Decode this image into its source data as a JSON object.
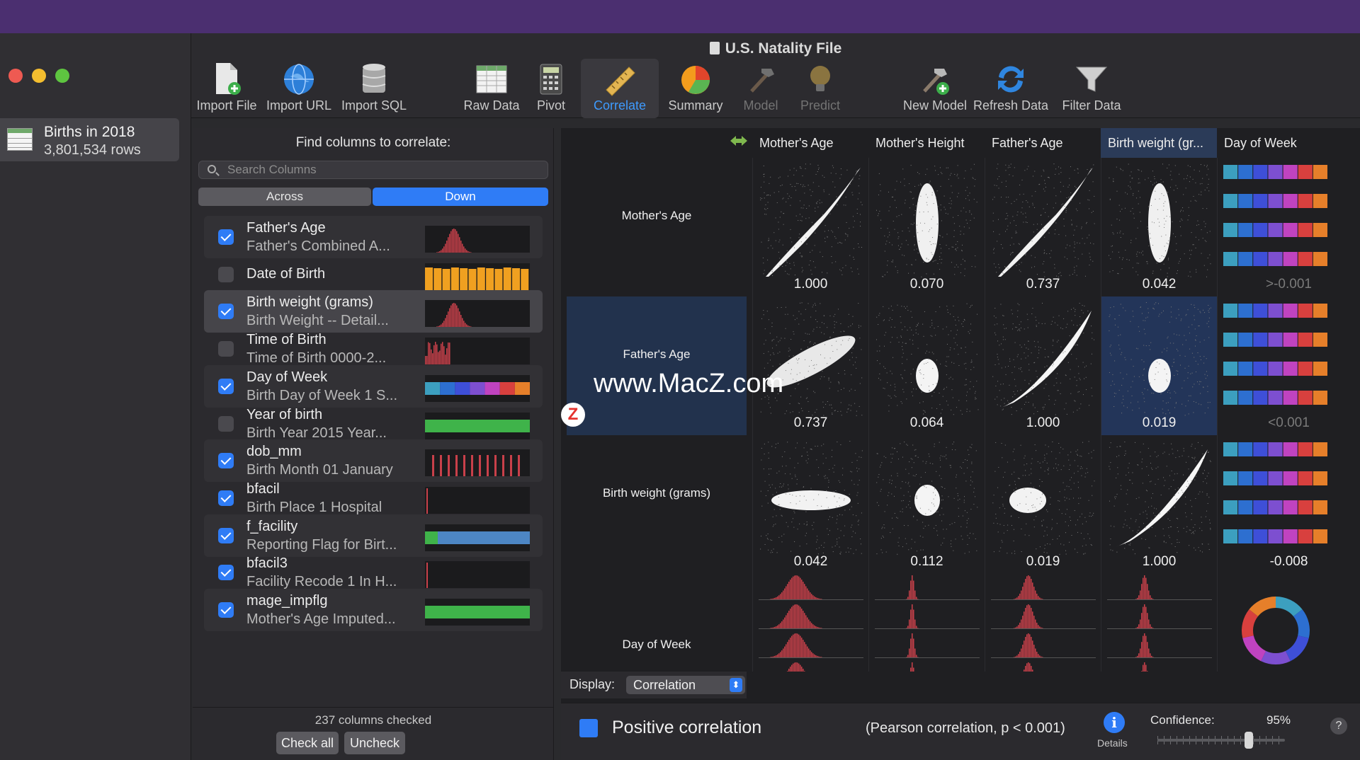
{
  "window": {
    "title": "U.S. Natality File"
  },
  "sidebar": {
    "dataset_title": "Births in 2018",
    "dataset_rows": "3,801,534 rows"
  },
  "toolbar": {
    "import_file": "Import File",
    "import_url": "Import URL",
    "import_sql": "Import SQL",
    "raw_data": "Raw Data",
    "pivot": "Pivot",
    "correlate": "Correlate",
    "summary": "Summary",
    "model": "Model",
    "predict": "Predict",
    "new_model": "New Model",
    "refresh_data": "Refresh Data",
    "filter_data": "Filter Data"
  },
  "columns_panel": {
    "title": "Find columns to correlate:",
    "search_placeholder": "Search Columns",
    "seg_across": "Across",
    "seg_down": "Down",
    "selected_segment": "Down",
    "items": [
      {
        "name": "Father's Age",
        "desc": "Father's Combined A...",
        "checked": true,
        "chart": "hist"
      },
      {
        "name": "Date of Birth",
        "desc": "",
        "checked": false,
        "chart": "bars_orange"
      },
      {
        "name": "Birth weight (grams)",
        "desc": "Birth Weight -- Detail...",
        "checked": true,
        "chart": "hist"
      },
      {
        "name": "Time of Birth",
        "desc": "Time of Birth 0000-2...",
        "checked": false,
        "chart": "hist_left"
      },
      {
        "name": "Day of Week",
        "desc": "Birth Day of Week 1 S...",
        "checked": true,
        "chart": "colors"
      },
      {
        "name": "Year of birth",
        "desc": "Birth Year 2015 Year...",
        "checked": false,
        "chart": "green"
      },
      {
        "name": "dob_mm",
        "desc": "Birth Month 01 January",
        "checked": true,
        "chart": "spikes"
      },
      {
        "name": "bfacil",
        "desc": "Birth Place 1 Hospital",
        "checked": true,
        "chart": "single_spike"
      },
      {
        "name": "f_facility",
        "desc": "Reporting Flag for Birt...",
        "checked": true,
        "chart": "green_blue"
      },
      {
        "name": "bfacil3",
        "desc": "Facility Recode 1 In H...",
        "checked": true,
        "chart": "single_spike"
      },
      {
        "name": "mage_impflg",
        "desc": "Mother's Age Imputed...",
        "checked": true,
        "chart": "green"
      }
    ],
    "columns_checked": "237 columns checked",
    "check_all": "Check all",
    "uncheck": "Uncheck"
  },
  "matrix": {
    "columns": [
      "Mother's Age",
      "Mother's Height",
      "Father's Age",
      "Birth weight (gr...",
      "Day of Week"
    ],
    "rows": [
      {
        "label": "Mother's Age",
        "values": [
          "1.000",
          "0.070",
          "0.737",
          "0.042",
          ">-0.001"
        ]
      },
      {
        "label": "Father's Age",
        "values": [
          "0.737",
          "0.064",
          "1.000",
          "0.019",
          "<0.001"
        ]
      },
      {
        "label": "Birth weight (grams)",
        "values": [
          "0.042",
          "0.112",
          "0.019",
          "1.000",
          "-0.008"
        ]
      },
      {
        "label": "Day of Week",
        "values": []
      }
    ],
    "display_label": "Display:",
    "display_value": "Correlation"
  },
  "footer": {
    "legend": "Positive correlation",
    "pearson": "(Pearson correlation, p < 0.001)",
    "details": "Details",
    "confidence_label": "Confidence:",
    "confidence_value": "95%",
    "confidence_level": 0.95,
    "help": "?"
  },
  "watermark": "www.MacZ.com",
  "watermark_logo": "Z",
  "colors": {
    "accent": "#2f7cf6",
    "hist": "#c9404a",
    "orange": "#f0a020",
    "green": "#3fb34a",
    "dow": [
      "#3c9fbf",
      "#2d6fd0",
      "#3e4fd8",
      "#7d4fd0",
      "#c043c0",
      "#d8403e",
      "#e67f2a"
    ]
  }
}
